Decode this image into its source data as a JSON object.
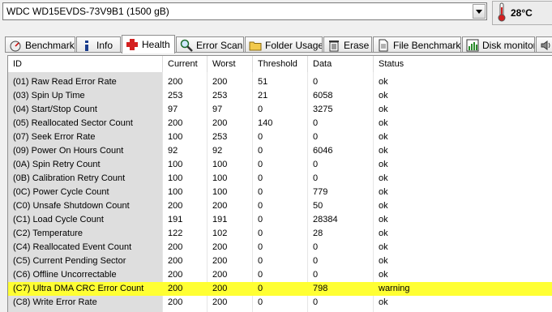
{
  "drive": {
    "label": "WDC WD15EVDS-73V9B1 (1500 gB)"
  },
  "temperature": {
    "value": "28°C"
  },
  "tabs": [
    {
      "label": "Benchmark",
      "icon": "benchmark-icon"
    },
    {
      "label": "Info",
      "icon": "info-icon"
    },
    {
      "label": "Health",
      "icon": "health-cross-icon",
      "active": true
    },
    {
      "label": "Error Scan",
      "icon": "magnifier-icon"
    },
    {
      "label": "Folder Usage",
      "icon": "folder-icon"
    },
    {
      "label": "Erase",
      "icon": "trash-icon"
    },
    {
      "label": "File Benchmark",
      "icon": "file-icon"
    },
    {
      "label": "Disk monitor",
      "icon": "chart-icon"
    }
  ],
  "columns": {
    "id": "ID",
    "current": "Current",
    "worst": "Worst",
    "threshold": "Threshold",
    "data": "Data",
    "status": "Status"
  },
  "rows": [
    {
      "id": "(01) Raw Read Error Rate",
      "current": "200",
      "worst": "200",
      "threshold": "51",
      "data": "0",
      "status": "ok"
    },
    {
      "id": "(03) Spin Up Time",
      "current": "253",
      "worst": "253",
      "threshold": "21",
      "data": "6058",
      "status": "ok"
    },
    {
      "id": "(04) Start/Stop Count",
      "current": "97",
      "worst": "97",
      "threshold": "0",
      "data": "3275",
      "status": "ok"
    },
    {
      "id": "(05) Reallocated Sector Count",
      "current": "200",
      "worst": "200",
      "threshold": "140",
      "data": "0",
      "status": "ok"
    },
    {
      "id": "(07) Seek Error Rate",
      "current": "100",
      "worst": "253",
      "threshold": "0",
      "data": "0",
      "status": "ok"
    },
    {
      "id": "(09) Power On Hours Count",
      "current": "92",
      "worst": "92",
      "threshold": "0",
      "data": "6046",
      "status": "ok"
    },
    {
      "id": "(0A) Spin Retry Count",
      "current": "100",
      "worst": "100",
      "threshold": "0",
      "data": "0",
      "status": "ok"
    },
    {
      "id": "(0B) Calibration Retry Count",
      "current": "100",
      "worst": "100",
      "threshold": "0",
      "data": "0",
      "status": "ok"
    },
    {
      "id": "(0C) Power Cycle Count",
      "current": "100",
      "worst": "100",
      "threshold": "0",
      "data": "779",
      "status": "ok"
    },
    {
      "id": "(C0) Unsafe Shutdown Count",
      "current": "200",
      "worst": "200",
      "threshold": "0",
      "data": "50",
      "status": "ok"
    },
    {
      "id": "(C1) Load Cycle Count",
      "current": "191",
      "worst": "191",
      "threshold": "0",
      "data": "28384",
      "status": "ok"
    },
    {
      "id": "(C2) Temperature",
      "current": "122",
      "worst": "102",
      "threshold": "0",
      "data": "28",
      "status": "ok"
    },
    {
      "id": "(C4) Reallocated Event Count",
      "current": "200",
      "worst": "200",
      "threshold": "0",
      "data": "0",
      "status": "ok"
    },
    {
      "id": "(C5) Current Pending Sector",
      "current": "200",
      "worst": "200",
      "threshold": "0",
      "data": "0",
      "status": "ok"
    },
    {
      "id": "(C6) Offline Uncorrectable",
      "current": "200",
      "worst": "200",
      "threshold": "0",
      "data": "0",
      "status": "ok"
    },
    {
      "id": "(C7) Ultra DMA CRC Error Count",
      "current": "200",
      "worst": "200",
      "threshold": "0",
      "data": "798",
      "status": "warning",
      "highlight": true
    },
    {
      "id": "(C8) Write Error Rate",
      "current": "200",
      "worst": "200",
      "threshold": "0",
      "data": "0",
      "status": "ok"
    }
  ],
  "colors": {
    "warning_highlight": "#ffff33",
    "id_column_bg": "#dedede",
    "health_icon": "#d42020"
  }
}
